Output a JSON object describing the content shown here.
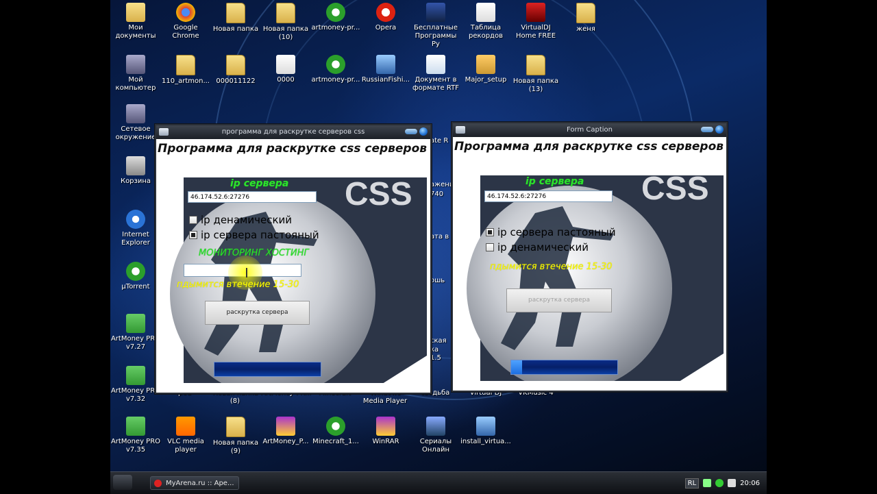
{
  "desktop": {
    "icons": [
      {
        "label": "Мои документы",
        "icon": "my-documents-folder-icon",
        "col": 0,
        "row": 0
      },
      {
        "label": "Google Chrome",
        "icon": "chrome-icon",
        "col": 1,
        "row": 0
      },
      {
        "label": "Новая папка",
        "icon": "folder-icon",
        "col": 2,
        "row": 0
      },
      {
        "label": "Новая папка (10)",
        "icon": "folder-icon",
        "col": 3,
        "row": 0
      },
      {
        "label": "artmoney-pr...",
        "icon": "utorrent-file-icon",
        "col": 4,
        "row": 0
      },
      {
        "label": "Opera",
        "icon": "opera-icon",
        "col": 5,
        "row": 0
      },
      {
        "label": "Бесплатные Программы Ру",
        "icon": "website-icon",
        "col": 6,
        "row": 0
      },
      {
        "label": "Таблица рекордов",
        "icon": "ie-file-icon",
        "col": 7,
        "row": 0
      },
      {
        "label": "VirtualDJ Home FREE",
        "icon": "virtualdj-icon",
        "col": 8,
        "row": 0
      },
      {
        "label": "женя",
        "icon": "folder-icon",
        "col": 9,
        "row": 0
      },
      {
        "label": "Мой компьютер",
        "icon": "my-computer-icon",
        "col": 0,
        "row": 1
      },
      {
        "label": "110_artmon...",
        "icon": "folder-icon",
        "col": 1,
        "row": 1
      },
      {
        "label": "000011122",
        "icon": "folder-icon",
        "col": 2,
        "row": 1
      },
      {
        "label": "0000",
        "icon": "text-file-icon",
        "col": 3,
        "row": 1
      },
      {
        "label": "artmoney-pr...",
        "icon": "utorrent-file-icon",
        "col": 4,
        "row": 1
      },
      {
        "label": "RussianFishi...",
        "icon": "installer-icon",
        "col": 5,
        "row": 1
      },
      {
        "label": "Документ в формате RTF",
        "icon": "rtf-file-icon",
        "col": 6,
        "row": 1
      },
      {
        "label": "Major_setup",
        "icon": "setup-icon",
        "col": 7,
        "row": 1
      },
      {
        "label": "Новая папка (13)",
        "icon": "folder-icon",
        "col": 8,
        "row": 1
      },
      {
        "label": "Сетевое окружение",
        "icon": "network-icon",
        "col": 0,
        "row": 2
      },
      {
        "label": "Корзина",
        "icon": "recycle-bin-icon",
        "col": 0,
        "row": 3
      },
      {
        "label": "Internet Explorer",
        "icon": "ie-icon",
        "col": 0,
        "row": 4
      },
      {
        "label": "µTorrent",
        "icon": "utorrent-icon",
        "col": 0,
        "row": 5
      },
      {
        "label": "ArtMoney PRO v7.27",
        "icon": "artmoney-icon",
        "col": 0,
        "row": 6
      },
      {
        "label": "ArtMoney PRO v7.32",
        "icon": "artmoney-icon",
        "col": 0,
        "row": 7
      },
      {
        "label": "ArtMoney PRO v7.35",
        "icon": "artmoney-icon",
        "col": 0,
        "row": 8
      },
      {
        "label": "VLC media player",
        "icon": "vlc-icon",
        "col": 1,
        "row": 8
      },
      {
        "label": "Новая папка (9)",
        "icon": "folder-icon",
        "col": 2,
        "row": 8
      },
      {
        "label": "ArtMoney_P...",
        "icon": "winrar-archive-icon",
        "col": 3,
        "row": 8
      },
      {
        "label": "Minecraft_1...",
        "icon": "utorrent-file-icon",
        "col": 4,
        "row": 8
      },
      {
        "label": "WinRAR",
        "icon": "winrar-icon",
        "col": 5,
        "row": 8
      },
      {
        "label": "Сериалы Онлайн",
        "icon": "tv-icon",
        "col": 6,
        "row": 8
      },
      {
        "label": "install_virtua...",
        "icon": "installer-icon",
        "col": 7,
        "row": 8
      }
    ],
    "partial_labels": [
      {
        "text": "ipod",
        "id": "ipod"
      },
      {
        "text": "Новая папка (8)",
        "id": "folder8"
      },
      {
        "text": "ArtMoney PR...",
        "id": "artmoney-pr"
      },
      {
        "text": "Minecraft",
        "id": "minecraft"
      },
      {
        "text": "Windows Media Player",
        "id": "wmp"
      },
      {
        "text": "свадьба",
        "id": "svadba"
      },
      {
        "text": "Virtual DJ",
        "id": "virtualdj"
      },
      {
        "text": "VKMusic 4",
        "id": "vkmusic"
      },
      {
        "text": "ate R",
        "id": "ate-r"
      },
      {
        "text": "ажени",
        "id": "azheni"
      },
      {
        "text": "740",
        "id": "n740"
      },
      {
        "text": "ата в",
        "id": "ata-v"
      },
      {
        "text": "ошь",
        "id": "osh"
      },
      {
        "text": "ская",
        "id": "skaya"
      },
      {
        "text": "ка 1.5",
        "id": "ka15"
      }
    ]
  },
  "window_left": {
    "title": "программа для раскрутке серверов css",
    "heading": "Программа для раскрутке css серверов",
    "ip_label": "ip сервера",
    "ip_value": "46.174.52.6:27276",
    "checkbox1_label": "ip денамический",
    "checkbox1_checked": false,
    "checkbox2_label": "ip сервера пастояный",
    "checkbox2_checked": true,
    "monitoring_label": "МОНИТОРИНГ ХОСТИНГ",
    "monitoring_value": "",
    "wait_text": "пдымится втечение 15-30",
    "button_label": "раскрутка сервера",
    "progress": 0
  },
  "window_right": {
    "title": "Form Caption",
    "heading": "Программа для раскрутке css серверов",
    "ip_label": "ip сервера",
    "ip_value": "46.174.52.6:27276",
    "checkbox1_label": "ip сервера пастояный",
    "checkbox1_checked": true,
    "checkbox2_label": "ip денамический",
    "checkbox2_checked": false,
    "wait_text": "пдымится втечение 15-30",
    "button_label": "раскрутка сервера",
    "progress": 0.1
  },
  "logo_text": "CSS",
  "taskbar": {
    "task_label": "MyArena.ru :: Аре...",
    "lang": "RL",
    "clock": "20:06"
  }
}
